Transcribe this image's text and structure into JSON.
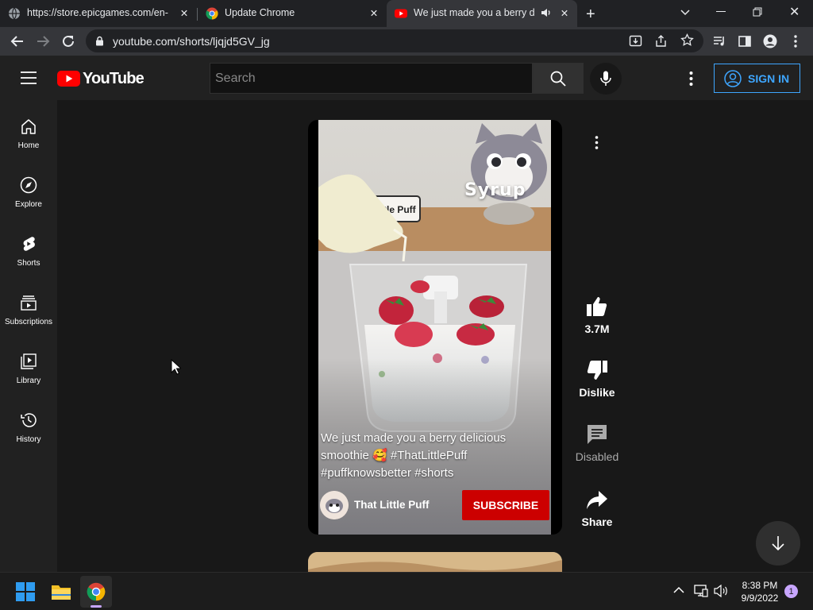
{
  "browser": {
    "tabs": [
      {
        "title": "https://store.epicgames.com/en-",
        "icon": "globe-icon"
      },
      {
        "title": "Update Chrome",
        "icon": "chrome-icon"
      },
      {
        "title": "We just made you a berry de",
        "icon": "youtube-icon",
        "active": true
      }
    ],
    "url": "youtube.com/shorts/ljqjd5GV_jg"
  },
  "youtube": {
    "logo_text": "YouTube",
    "search_placeholder": "Search",
    "sign_in": "SIGN IN"
  },
  "sidebar": {
    "items": [
      {
        "label": "Home",
        "icon": "home-icon"
      },
      {
        "label": "Explore",
        "icon": "compass-icon"
      },
      {
        "label": "Shorts",
        "icon": "shorts-icon"
      },
      {
        "label": "Subscriptions",
        "icon": "subscriptions-icon"
      },
      {
        "label": "Library",
        "icon": "library-icon"
      },
      {
        "label": "History",
        "icon": "history-icon"
      }
    ]
  },
  "short": {
    "overlay_text": "Syrup",
    "sign_text": "Little Puff",
    "caption": "We just made you a berry delicious smoothie 🥰 #ThatLittlePuff #puffknowsbetter #shorts",
    "channel": "That Little Puff",
    "subscribe": "SUBSCRIBE"
  },
  "actions": {
    "likes": "3.7M",
    "dislike": "Dislike",
    "comments": "Disabled",
    "share": "Share"
  },
  "taskbar": {
    "time": "8:38 PM",
    "date": "9/9/2022",
    "notifications": "1"
  },
  "colors": {
    "youtube_red": "#ff0000",
    "subscribe_red": "#cc0000",
    "link_blue": "#3ea6ff"
  }
}
